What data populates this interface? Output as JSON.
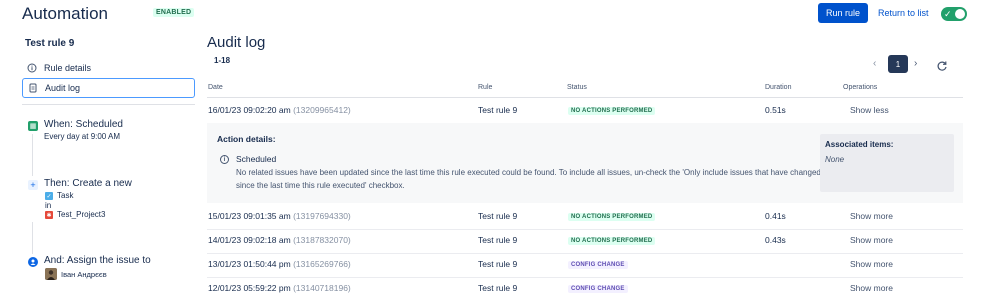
{
  "header": {
    "title": "Automation",
    "status_badge": "ENABLED",
    "run_rule_label": "Run rule",
    "return_label": "Return to list",
    "toggle_on": true
  },
  "sidebar": {
    "rule_name": "Test rule 9",
    "nav": [
      {
        "label": "Rule details",
        "icon": "info-icon"
      },
      {
        "label": "Audit log",
        "icon": "document-icon",
        "active": true
      }
    ],
    "steps": {
      "when_title": "When: Scheduled",
      "when_sub": "Every day at 9:00 AM",
      "then_title": "Then: Create a new",
      "then_issue_type": "Task",
      "then_in": "in",
      "then_project": "Test_Project3",
      "and_title": "And: Assign the issue to",
      "and_user": "Іван Андрєєв"
    }
  },
  "main": {
    "title": "Audit log",
    "range": "1-18",
    "pagination": {
      "current_page": "1"
    },
    "columns": [
      "Date",
      "Rule",
      "Status",
      "Duration",
      "Operations"
    ],
    "rows": [
      {
        "date": "16/01/23 09:02:20 am",
        "id": "(13209965412)",
        "rule": "Test rule 9",
        "status": "NO ACTIONS PERFORMED",
        "status_color": "#216e4e",
        "duration": "0.51s",
        "op": "Show less"
      },
      {
        "date": "15/01/23 09:01:35 am",
        "id": "(13197694330)",
        "rule": "Test rule 9",
        "status": "NO ACTIONS PERFORMED",
        "status_color": "#216e4e",
        "duration": "0.41s",
        "op": "Show more"
      },
      {
        "date": "14/01/23 09:02:18 am",
        "id": "(13187832070)",
        "rule": "Test rule 9",
        "status": "NO ACTIONS PERFORMED",
        "status_color": "#216e4e",
        "duration": "0.43s",
        "op": "Show more"
      },
      {
        "date": "13/01/23 01:50:44 pm",
        "id": "(13165269766)",
        "rule": "Test rule 9",
        "status": "CONFIG CHANGE",
        "status_color": "#5e4db2",
        "duration": "",
        "op": "Show more"
      },
      {
        "date": "12/01/23 05:59:22 pm",
        "id": "(13140718196)",
        "rule": "Test rule 9",
        "status": "CONFIG CHANGE",
        "status_color": "#5e4db2",
        "duration": "",
        "op": "Show more"
      }
    ],
    "details": {
      "title": "Action details:",
      "item_head": "Scheduled",
      "item_body": "No related issues have been updated since the last time this rule executed could be found. To include all issues, un-check the 'Only include issues that have changed since the last time this rule executed' checkbox.",
      "assoc_title": "Associated items:",
      "assoc_value": "None"
    }
  },
  "colors": {
    "primary": "#0052cc",
    "toggle": "#22a06b",
    "step_green": "#22a06b",
    "step_blue": "#0c66e4",
    "project_red": "#e5493a"
  }
}
